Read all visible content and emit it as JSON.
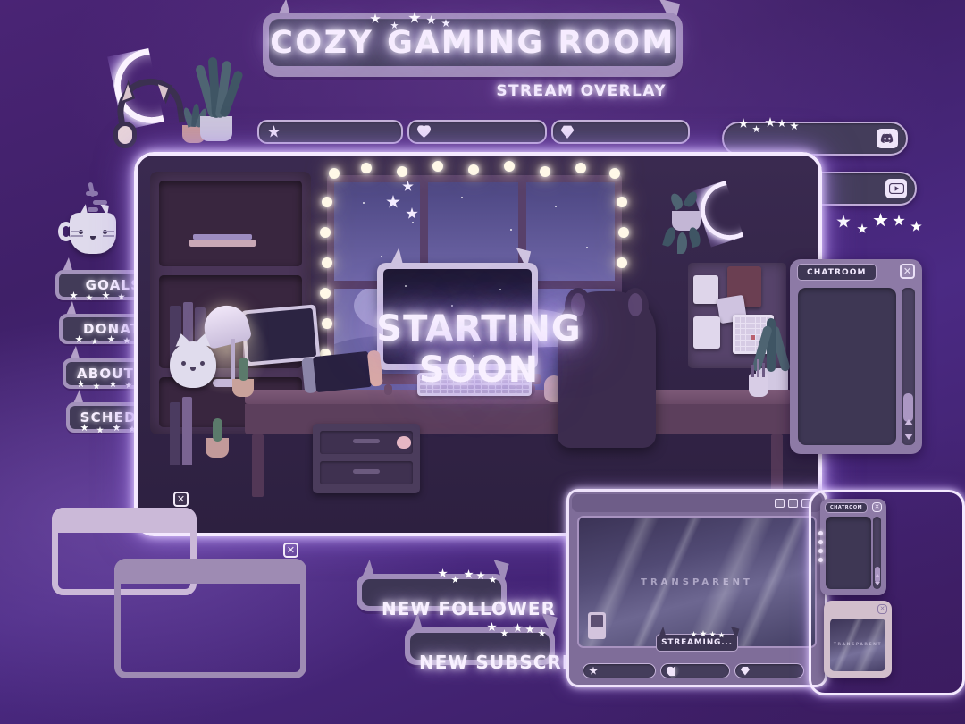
{
  "meta": {
    "title": "COZY GAMING ROOM",
    "subtitle": "STREAM OVERLAY",
    "accent": "#f4e9ff",
    "panel_bg": "#3e3754",
    "frame_lilac": "#cbb9d8",
    "background_purple": "#4a2475"
  },
  "top_statbar": {
    "segments": [
      {
        "icon": "star-icon",
        "value": ""
      },
      {
        "icon": "heart-icon",
        "value": ""
      },
      {
        "icon": "gem-icon",
        "value": ""
      }
    ]
  },
  "social_bars": [
    {
      "name": "discord-bar",
      "icon": "discord-icon",
      "value": ""
    },
    {
      "name": "youtube-bar",
      "icon": "youtube-icon",
      "value": ""
    }
  ],
  "sidebar": {
    "items": [
      {
        "label": "GOALS"
      },
      {
        "label": "DONATE"
      },
      {
        "label": "ABOUT ME"
      },
      {
        "label": "SCHEDULE"
      }
    ]
  },
  "scene": {
    "screen_text": "STARTING SOON"
  },
  "chatroom_panel": {
    "tab_label": "CHATROOM",
    "close_label": "✕",
    "messages": []
  },
  "mini_chatroom_panel": {
    "tab_label": "CHATROOM",
    "close_label": "✕"
  },
  "ghost_windows": [
    {
      "name": "ghost-window-back",
      "close_label": "✕"
    },
    {
      "name": "ghost-window-front",
      "close_label": "✕"
    }
  ],
  "alerts": [
    {
      "label": "NEW FOLLOWER"
    },
    {
      "label": "NEW SUBSCRIBER"
    }
  ],
  "cam_panel": {
    "watermark": "TRANSPARENT",
    "status_tag": "STREAMING...",
    "window_controls": [
      "minimize",
      "maximize",
      "close"
    ],
    "statbar": {
      "segments": [
        {
          "icon": "star-icon"
        },
        {
          "icon": "heart-icon"
        },
        {
          "icon": "gem-icon"
        }
      ]
    }
  },
  "mini_cam_panel": {
    "watermark": "TRANSPARENT",
    "close_label": "✕"
  },
  "decorations": {
    "star_garland_count": 5,
    "neon_moon": "moon-icon",
    "cat_mug": "cat-mug-icon",
    "headphones": "cat-headphones-icon"
  }
}
